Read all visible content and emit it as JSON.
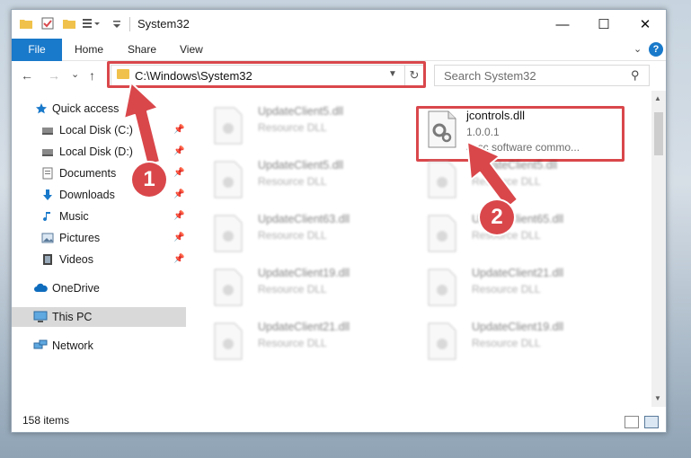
{
  "window": {
    "title": "System32"
  },
  "titlebar": {
    "minimize": "—",
    "maximize": "☐",
    "close": "✕"
  },
  "ribbon": {
    "tabs": [
      "File",
      "Home",
      "Share",
      "View"
    ],
    "help": "?"
  },
  "nav": {
    "back": "←",
    "forward": "→",
    "recent": "⌄",
    "up": "↑",
    "address": "C:\\Windows\\System32",
    "search_placeholder": "Search System32"
  },
  "sidebar": {
    "items": [
      {
        "label": "Quick access",
        "icon": "star-icon",
        "pinned": false
      },
      {
        "label": "Local Disk (C:)",
        "icon": "drive-icon",
        "pinned": true
      },
      {
        "label": "Local Disk (D:)",
        "icon": "drive-icon",
        "pinned": true
      },
      {
        "label": "Documents",
        "icon": "documents-icon",
        "pinned": true
      },
      {
        "label": "Downloads",
        "icon": "downloads-icon",
        "pinned": true
      },
      {
        "label": "Music",
        "icon": "music-icon",
        "pinned": true
      },
      {
        "label": "Pictures",
        "icon": "pictures-icon",
        "pinned": true
      },
      {
        "label": "Videos",
        "icon": "videos-icon",
        "pinned": true
      },
      {
        "label": "OneDrive",
        "icon": "cloud-icon",
        "pinned": false
      },
      {
        "label": "This PC",
        "icon": "computer-icon",
        "pinned": false,
        "selected": true
      },
      {
        "label": "Network",
        "icon": "network-icon",
        "pinned": false
      }
    ]
  },
  "files": {
    "highlighted": {
      "name": "jcontrols.dll",
      "version": "1.0.0.1",
      "description": "Jasc software commo..."
    },
    "left_column": [
      {
        "name": "UpdateClient5.dll",
        "type": "Resource DLL"
      },
      {
        "name": "UpdateClient5.dll",
        "type": "Resource DLL"
      },
      {
        "name": "UpdateClient63.dll",
        "type": "Resource DLL"
      },
      {
        "name": "UpdateClient19.dll",
        "type": "Resource DLL"
      },
      {
        "name": "UpdateClient21.dll",
        "type": "Resource DLL"
      }
    ],
    "right_column": [
      {
        "name": "UpdateClient5.dll",
        "type": "Resource DLL"
      },
      {
        "name": "UpdateClient65.dll",
        "type": "Resource DLL"
      },
      {
        "name": "UpdateClient21.dll",
        "type": "Resource DLL"
      },
      {
        "name": "UpdateClient19.dll",
        "type": "Resource DLL"
      }
    ]
  },
  "status": {
    "count": "158 items"
  },
  "callouts": [
    "1",
    "2"
  ],
  "colors": {
    "accent": "#1979ca",
    "highlight": "#d9474b",
    "folder": "#f0c24b"
  }
}
